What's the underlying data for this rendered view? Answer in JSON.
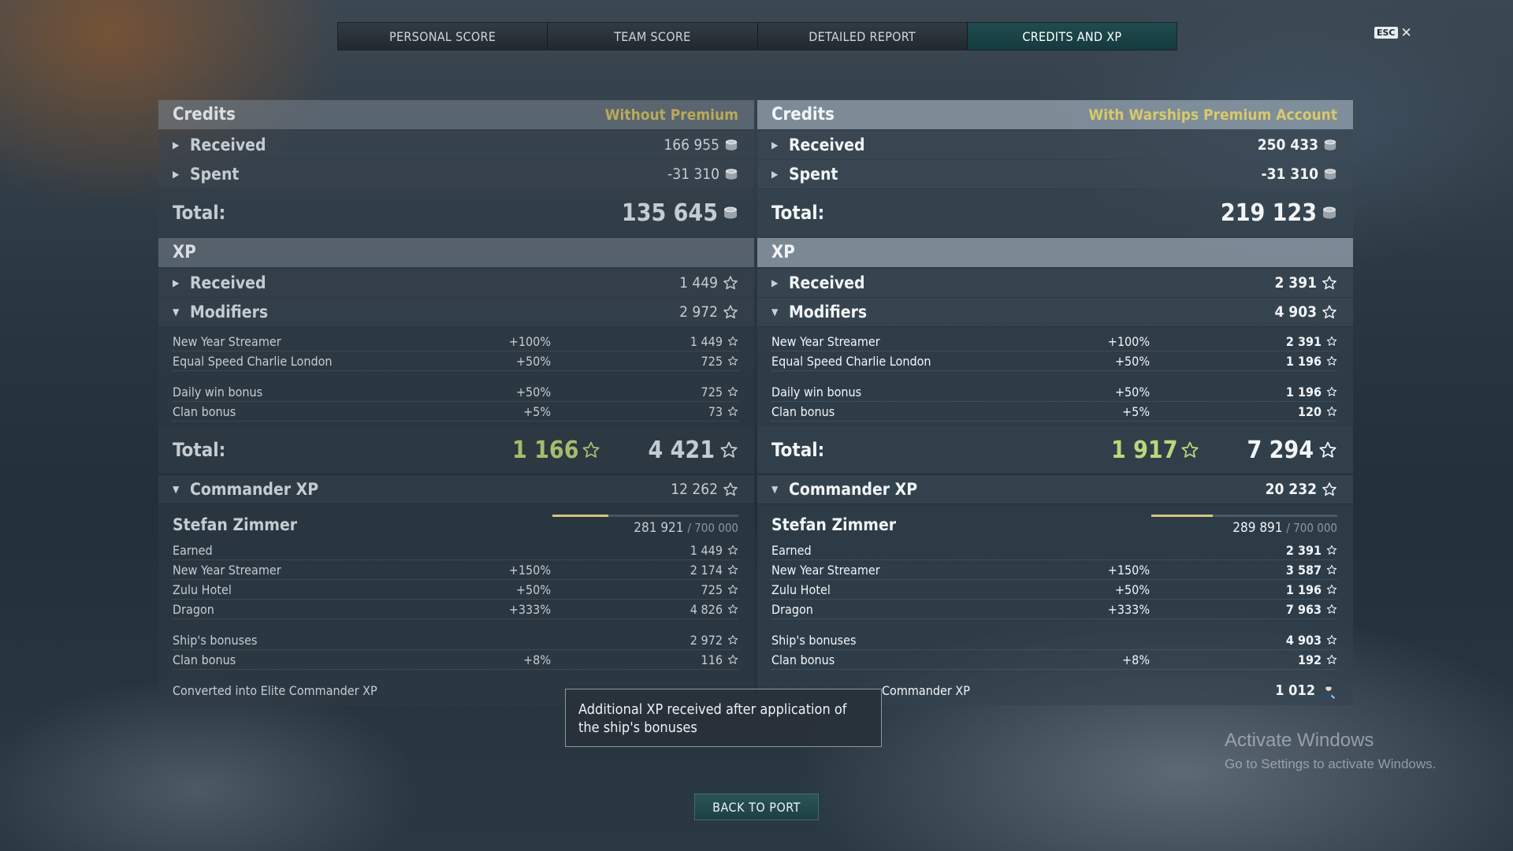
{
  "tabs": [
    {
      "label": "PERSONAL SCORE"
    },
    {
      "label": "TEAM SCORE"
    },
    {
      "label": "DETAILED REPORT"
    },
    {
      "label": "CREDITS AND XP",
      "active": true
    }
  ],
  "esc": {
    "key": "ESC",
    "close": "✕"
  },
  "left": {
    "credits_title": "Credits",
    "credits_sub": "Without Premium",
    "received_label": "Received",
    "received_value": "166 955",
    "spent_label": "Spent",
    "spent_value": "-31 310",
    "total_label": "Total:",
    "credits_total": "135 645",
    "xp_title": "XP",
    "xp_received_label": "Received",
    "xp_received_value": "1 449",
    "modifiers_label": "Modifiers",
    "modifiers_value": "2 972",
    "modifiers": [
      {
        "name": "New Year Streamer",
        "pct": "+100%",
        "amt": "1 449"
      },
      {
        "name": "Equal Speed Charlie London",
        "pct": "+50%",
        "amt": "725"
      },
      {
        "name": "Daily win bonus",
        "pct": "+50%",
        "amt": "725"
      },
      {
        "name": "Clan bonus",
        "pct": "+5%",
        "amt": "73"
      }
    ],
    "xp_total_free": "1 166",
    "xp_total": "4 421",
    "cmd_label": "Commander XP",
    "cmd_value": "12 262",
    "cmd_name": "Stefan Zimmer",
    "cmd_progress": "281 921",
    "cmd_progress_max": "/ 700 000",
    "cmd_progress_fraction": 0.3,
    "cmd_rows": [
      {
        "name": "Earned",
        "pct": "",
        "amt": "1 449"
      },
      {
        "name": "New Year Streamer",
        "pct": "+150%",
        "amt": "2 174"
      },
      {
        "name": "Zulu Hotel",
        "pct": "+50%",
        "amt": "725"
      },
      {
        "name": "Dragon",
        "pct": "+333%",
        "amt": "4 826"
      }
    ],
    "cmd_rows2": [
      {
        "name": "Ship's bonuses",
        "pct": "",
        "amt": "2 972"
      },
      {
        "name": "Clan bonus",
        "pct": "+8%",
        "amt": "116"
      }
    ],
    "converted_label": "Converted into Elite Commander XP"
  },
  "right": {
    "credits_title": "Credits",
    "credits_sub": "With Warships Premium Account",
    "received_label": "Received",
    "received_value": "250 433",
    "spent_label": "Spent",
    "spent_value": "-31 310",
    "total_label": "Total:",
    "credits_total": "219 123",
    "xp_title": "XP",
    "xp_received_label": "Received",
    "xp_received_value": "2 391",
    "modifiers_label": "Modifiers",
    "modifiers_value": "4 903",
    "modifiers": [
      {
        "name": "New Year Streamer",
        "pct": "+100%",
        "amt": "2 391"
      },
      {
        "name": "Equal Speed Charlie London",
        "pct": "+50%",
        "amt": "1 196"
      },
      {
        "name": "Daily win bonus",
        "pct": "+50%",
        "amt": "1 196"
      },
      {
        "name": "Clan bonus",
        "pct": "+5%",
        "amt": "120"
      }
    ],
    "xp_total_free": "1 917",
    "xp_total": "7 294",
    "cmd_label": "Commander XP",
    "cmd_value": "20 232",
    "cmd_name": "Stefan Zimmer",
    "cmd_progress": "289 891",
    "cmd_progress_max": "/ 700 000",
    "cmd_progress_fraction": 0.33,
    "cmd_rows": [
      {
        "name": "Earned",
        "pct": "",
        "amt": "2 391"
      },
      {
        "name": "New Year Streamer",
        "pct": "+150%",
        "amt": "3 587"
      },
      {
        "name": "Zulu Hotel",
        "pct": "+50%",
        "amt": "1 196"
      },
      {
        "name": "Dragon",
        "pct": "+333%",
        "amt": "7 963"
      }
    ],
    "cmd_rows2": [
      {
        "name": "Ship's bonuses",
        "pct": "",
        "amt": "4 903"
      },
      {
        "name": "Clan bonus",
        "pct": "+8%",
        "amt": "192"
      }
    ],
    "converted_label": "Commander XP",
    "converted_value": "1 012"
  },
  "tooltip": "Additional XP received after application of the ship's bonuses",
  "back_button": "BACK TO PORT",
  "watermark": {
    "title": "Activate Windows",
    "subtitle": "Go to Settings to activate Windows."
  },
  "colors": {
    "accent_tab": "#1f4d50",
    "premium_yellow": "#d9c96a",
    "free_xp_green": "#b8d87a"
  },
  "icons": {
    "coin": "credits-coin-icon",
    "star": "xp-star-icon",
    "commander": "commander-icon",
    "arrow": "chevron-icon"
  }
}
